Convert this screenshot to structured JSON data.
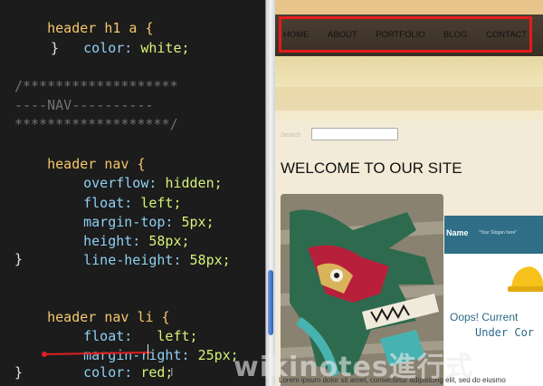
{
  "editor": {
    "lines": [
      {
        "kind": "rule",
        "selector": "header h1 a {"
      },
      {
        "kind": "decl",
        "property": "color:",
        "value": "white;"
      },
      {
        "kind": "close",
        "text": "}"
      },
      {
        "kind": "comment",
        "text": "/*******************"
      },
      {
        "kind": "comment",
        "text": "----NAV----------"
      },
      {
        "kind": "comment",
        "text": "*******************/"
      },
      {
        "kind": "rule",
        "selector": "header nav {"
      },
      {
        "kind": "decl",
        "property": "overflow:",
        "value": "hidden;"
      },
      {
        "kind": "decl",
        "property": "float:",
        "value": "left;"
      },
      {
        "kind": "decl",
        "property": "margin-top:",
        "value": "5px;"
      },
      {
        "kind": "decl",
        "property": "height:",
        "value": "58px;"
      },
      {
        "kind": "decl",
        "property": "line-height:",
        "value": "58px;"
      },
      {
        "kind": "close",
        "text": "}"
      },
      {
        "kind": "rule",
        "selector": "header nav li {"
      },
      {
        "kind": "decl",
        "property": "float:",
        "value": "left;"
      },
      {
        "kind": "decl",
        "property": "margin-right:",
        "value": "25px;"
      },
      {
        "kind": "decl",
        "property": "color:",
        "value": "red;"
      },
      {
        "kind": "close",
        "text": "}"
      }
    ],
    "scrollbar_position": 0.75,
    "strike_color": "#e02020"
  },
  "preview": {
    "nav_items": [
      "HOME",
      "ABOUT",
      "PORTFOLIO",
      "BLOG",
      "CONTACT"
    ],
    "nav_highlight_color": "#e41b1b",
    "search_label": "Search",
    "welcome": "WELCOME TO OUR SITE",
    "thumb": {
      "name": "Name",
      "slogan": "\"Your Slogan here\"",
      "oops": "Oops! Current",
      "under": "Under Cor"
    },
    "lorem": "Lorem ipsum dolor sit amet, consectetur adipisicing elit, sed do eiusmo"
  },
  "watermark": "wikinotes進行式",
  "colors": {
    "selector": "#f5c76a",
    "property": "#8ed0f2",
    "value": "#d6f27a",
    "comment": "#727272",
    "editor_bg": "#1c1c1c",
    "nav_bg": "#3f342a",
    "page_bg": "#f3ebd8"
  }
}
